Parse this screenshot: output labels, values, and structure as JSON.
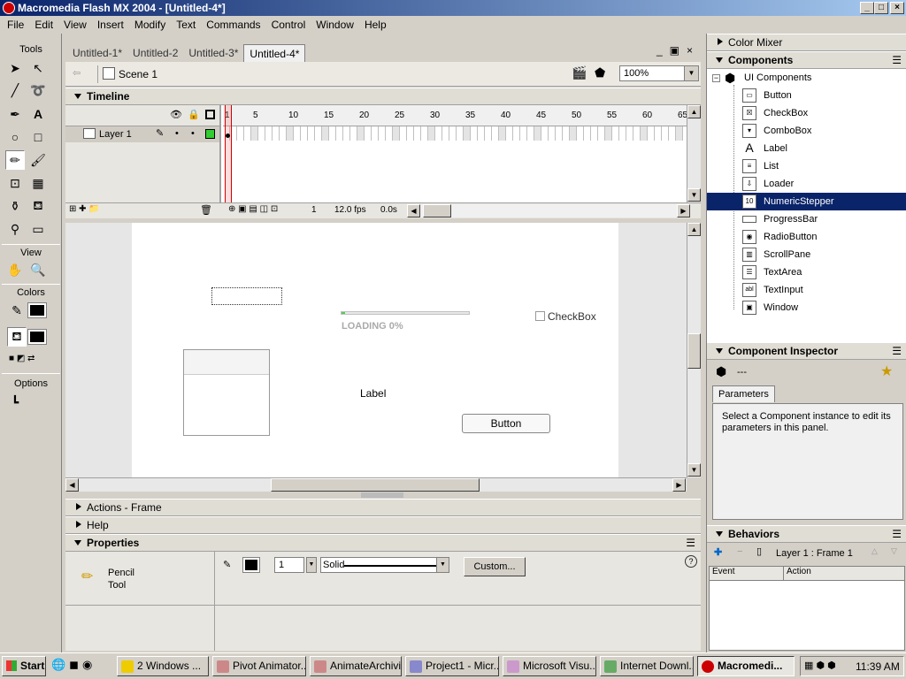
{
  "window": {
    "title": "Macromedia Flash MX 2004 - [Untitled-4*]"
  },
  "menu": [
    "File",
    "Edit",
    "View",
    "Insert",
    "Modify",
    "Text",
    "Commands",
    "Control",
    "Window",
    "Help"
  ],
  "tools": {
    "title": "Tools",
    "view_title": "View",
    "colors_title": "Colors",
    "options_title": "Options"
  },
  "doc_tabs": [
    "Untitled-1*",
    "Untitled-2",
    "Untitled-3*",
    "Untitled-4*"
  ],
  "editbar": {
    "scene": "Scene 1",
    "zoom": "100%"
  },
  "timeline": {
    "title": "Timeline",
    "layer": "Layer 1",
    "frame_numbers": [
      "1",
      "5",
      "10",
      "15",
      "20",
      "25",
      "30",
      "35",
      "40",
      "45",
      "50",
      "55",
      "60",
      "65"
    ],
    "current_frame": "1",
    "fps": "12.0 fps",
    "time": "0.0s"
  },
  "stage": {
    "loading": "LOADING 0%",
    "checkbox": "CheckBox",
    "label": "Label",
    "button": "Button"
  },
  "panels": {
    "actions": "Actions - Frame",
    "help": "Help",
    "properties": "Properties"
  },
  "properties": {
    "tool_line1": "Pencil",
    "tool_line2": "Tool",
    "stroke_size": "1",
    "stroke_style": "Solid",
    "custom": "Custom..."
  },
  "right": {
    "color_mixer": "Color Mixer",
    "components": "Components",
    "ui_components": "UI Components",
    "items": [
      "Button",
      "CheckBox",
      "ComboBox",
      "Label",
      "List",
      "Loader",
      "NumericStepper",
      "ProgressBar",
      "RadioButton",
      "ScrollPane",
      "TextArea",
      "TextInput",
      "Window"
    ],
    "selected_item": "NumericStepper",
    "inspector": "Component Inspector",
    "inspector_value": "---",
    "params_tab": "Parameters",
    "params_msg": "Select a Component instance to edit its parameters in this panel.",
    "behaviors": "Behaviors",
    "behaviors_target": "Layer 1 : Frame 1",
    "col_event": "Event",
    "col_action": "Action"
  },
  "taskbar": {
    "start": "Start",
    "tasks": [
      "2 Windows ...",
      "Pivot Animator...",
      "AnimateArchivi...",
      "Project1 - Micr...",
      "Microsoft Visu...",
      "Internet Downl...",
      "Macromedi..."
    ],
    "time": "11:39 AM"
  }
}
